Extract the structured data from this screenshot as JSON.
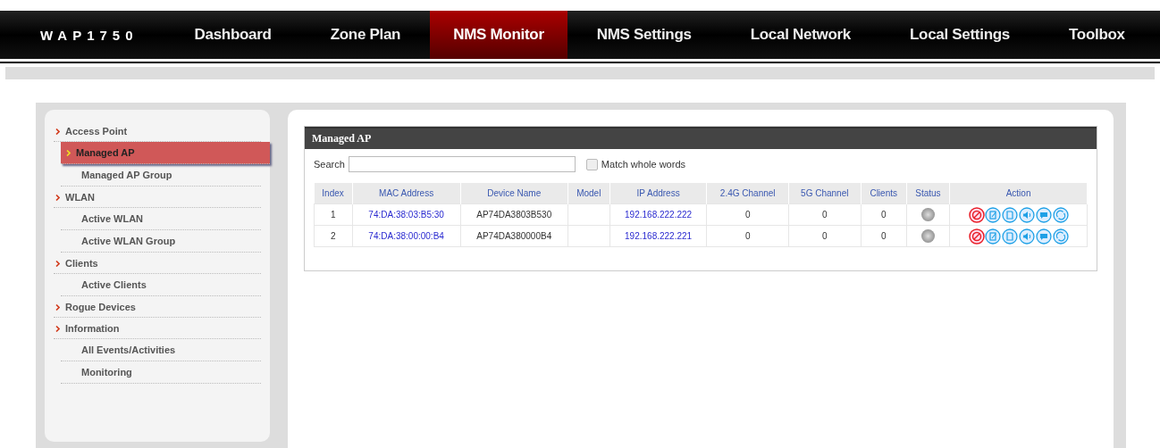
{
  "brand": "WAP1750",
  "nav": [
    {
      "label": "Dashboard",
      "selected": false
    },
    {
      "label": "Zone Plan",
      "selected": false
    },
    {
      "label": "NMS Monitor",
      "selected": true
    },
    {
      "label": "NMS Settings",
      "selected": false
    },
    {
      "label": "Local Network",
      "selected": false
    },
    {
      "label": "Local Settings",
      "selected": false
    },
    {
      "label": "Toolbox",
      "selected": false
    }
  ],
  "sidebar": [
    {
      "label": "Access Point",
      "children": [
        {
          "label": "Managed AP",
          "selected": true
        },
        {
          "label": "Managed AP Group",
          "selected": false
        }
      ]
    },
    {
      "label": "WLAN",
      "children": [
        {
          "label": "Active WLAN",
          "selected": false
        },
        {
          "label": "Active WLAN Group",
          "selected": false
        }
      ]
    },
    {
      "label": "Clients",
      "children": [
        {
          "label": "Active Clients",
          "selected": false
        }
      ]
    },
    {
      "label": "Rogue Devices"
    },
    {
      "label": "Information",
      "children": [
        {
          "label": "All Events/Activities",
          "selected": false
        },
        {
          "label": "Monitoring",
          "selected": false
        }
      ]
    }
  ],
  "panel": {
    "title": "Managed AP",
    "search_label": "Search",
    "match_whole_words": {
      "label": "Match whole words",
      "checked": false
    },
    "table": {
      "columns": [
        "Index",
        "MAC Address",
        "Device Name",
        "Model",
        "IP Address",
        "2.4G Channel",
        "5G Channel",
        "Clients",
        "Status",
        "Action"
      ],
      "rows": [
        {
          "index": "1",
          "mac": "74:DA:38:03:B5:30",
          "device_name": "AP74DA3803B530",
          "ip": "192.168.222.222",
          "channel_24g": "0",
          "channel_5g": "0",
          "clients": "0"
        },
        {
          "index": "2",
          "mac": "74:DA:38:00:00:B4",
          "device_name": "AP74DA380000B4",
          "ip": "192.168.222.221",
          "channel_24g": "0",
          "channel_5g": "0",
          "clients": "0"
        }
      ]
    }
  }
}
